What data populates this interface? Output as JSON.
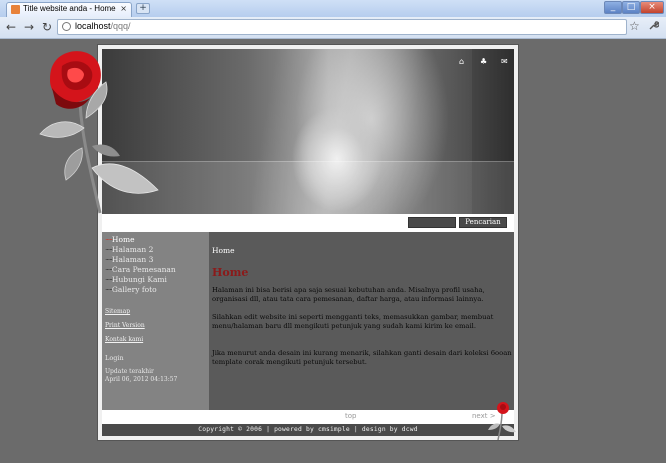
{
  "browser": {
    "tab_title": "Title website anda - Home",
    "tab_close": "×",
    "new_tab": "+",
    "url_host": "localhost",
    "url_path": "/qqq/",
    "window_min": "_",
    "window_max": "□",
    "window_close": "×",
    "back": "←",
    "forward": "→",
    "reload": "↻",
    "star": "☆",
    "wrench": "🔧"
  },
  "header_icons": {
    "home": "⌂",
    "sitemap": "♣",
    "mail": "✉"
  },
  "search": {
    "button_label": "Pencarian",
    "value": ""
  },
  "nav": [
    {
      "label": "Home",
      "active": true
    },
    {
      "label": "Halaman 2",
      "active": false
    },
    {
      "label": "Halaman 3",
      "active": false
    },
    {
      "label": "Cara Pemesanan",
      "active": false
    },
    {
      "label": "Hubungi Kami",
      "active": false
    },
    {
      "label": "Gallery foto",
      "active": false
    }
  ],
  "nav_dots": "·····",
  "sidebar_links": {
    "sitemap": "Sitemap",
    "print": "Print Version",
    "contact": "Kontak kami"
  },
  "sidebar_info": {
    "login": "Login",
    "updated_label": "Update terakhir",
    "updated_date": "April 06, 2012 04:13:57"
  },
  "content": {
    "breadcrumb": "Home",
    "title": "Home",
    "paragraphs": [
      "Halaman ini bisa berisi apa saja sesuai kebutuhan anda. Misalnya profil usaha, organisasi dll, atau tata cara pemesanan, daftar harga, atau informasi lainnya.",
      "Silahkan edit website ini seperti mengganti teks, memasukkan gambar, membuat menu/halaman baru dll mengikuti petunjuk yang sudah kami kirim ke email.",
      "Jika menurut anda desain ini kurang menarik, silahkan ganti desain dari koleksi 6ooan template corak mengikuti petunjuk tersebut."
    ]
  },
  "pagenav": {
    "top": "top",
    "next": "next >"
  },
  "footer": {
    "text": "Copyright © 2006 | powered by cmsimple | design by dcwd"
  },
  "colors": {
    "accent": "#8b1a1a",
    "page_bg": "#6b6b6b",
    "sidebar_bg": "#838383"
  }
}
